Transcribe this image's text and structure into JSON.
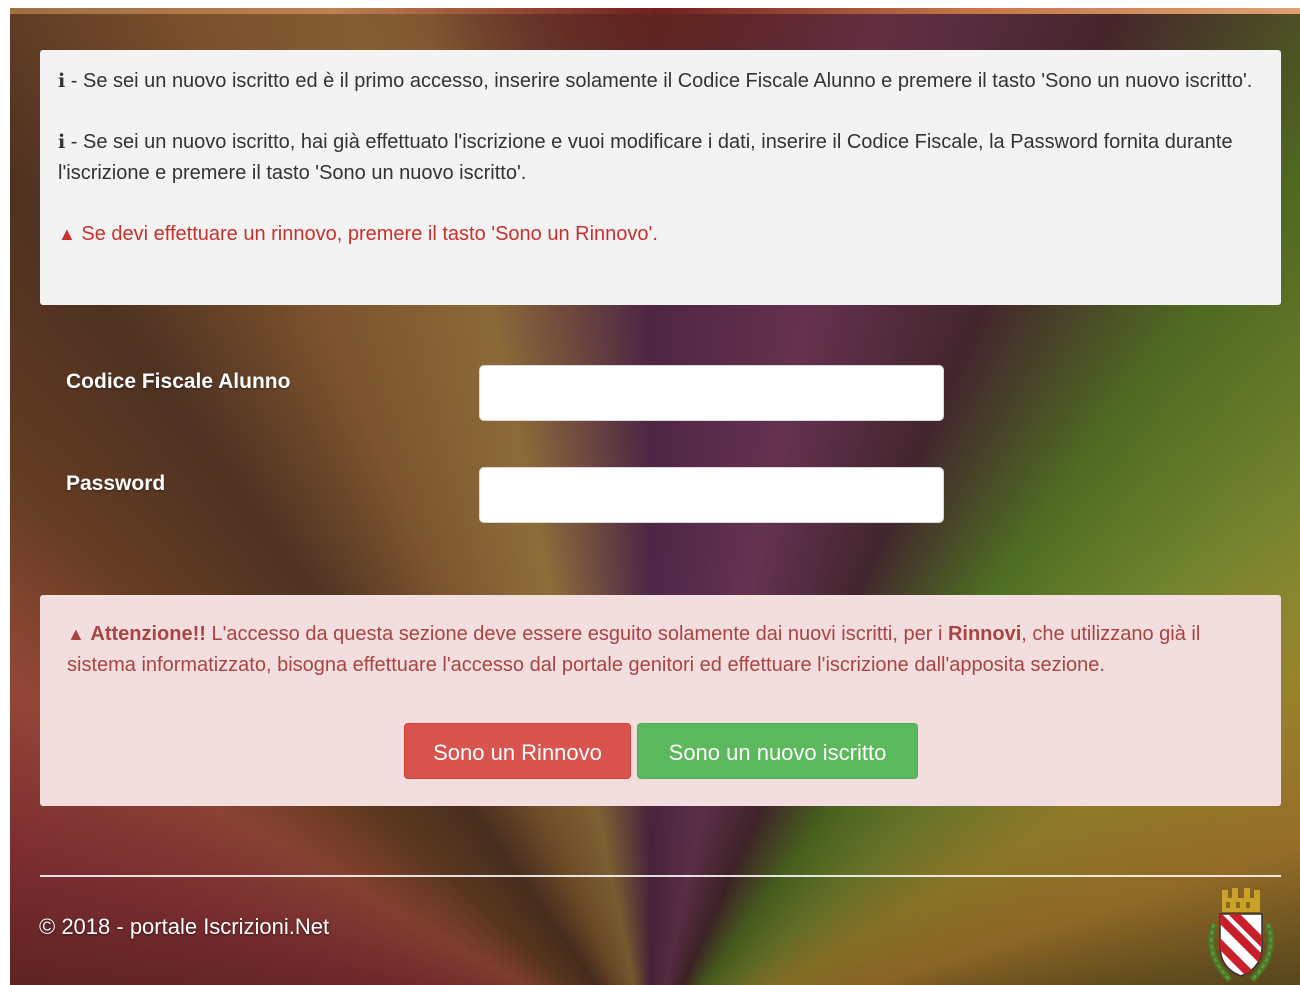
{
  "info": {
    "line1_text": " - Se sei un nuovo iscritto ed è il primo accesso, inserire solamente il Codice Fiscale Alunno e premere il tasto 'Sono un nuovo iscritto'.",
    "line2_text": " - Se sei un nuovo iscritto, hai già effettuato l'iscrizione e vuoi modificare i dati, inserire il Codice Fiscale, la Password fornita durante l'iscrizione e premere il tasto 'Sono un nuovo iscritto'.",
    "warning_text": " Se devi effettuare un rinnovo, premere il tasto 'Sono un Rinnovo'.",
    "info_icon": "i"
  },
  "form": {
    "codice_fiscale_label": "Codice Fiscale Alunno",
    "codice_fiscale_value": "",
    "password_label": "Password",
    "password_value": ""
  },
  "alert": {
    "title": "Attenzione!!",
    "text_before": " L'accesso da questa sezione deve essere esguito solamente dai nuovi iscritti, per i ",
    "bold_word": "Rinnovi",
    "text_after": ", che utilizzano già il sistema informatizzato, bisogna effettuare l'accesso dal portale genitori ed effettuare l'iscrizione dall'apposita sezione."
  },
  "buttons": {
    "renew_label": "Sono un Rinnovo",
    "new_label": "Sono un nuovo iscritto"
  },
  "footer": {
    "copyright": "© 2018 - portale Iscrizioni.Net"
  },
  "icons": {
    "warning": "warning-triangle-icon",
    "info": "info-icon",
    "crest": "municipal-crest-icon"
  },
  "colors": {
    "danger": "#d9534f",
    "success": "#5cb85c",
    "alert_bg": "#f2dede",
    "alert_text": "#a94442",
    "info_bg": "#f3f3f3"
  }
}
